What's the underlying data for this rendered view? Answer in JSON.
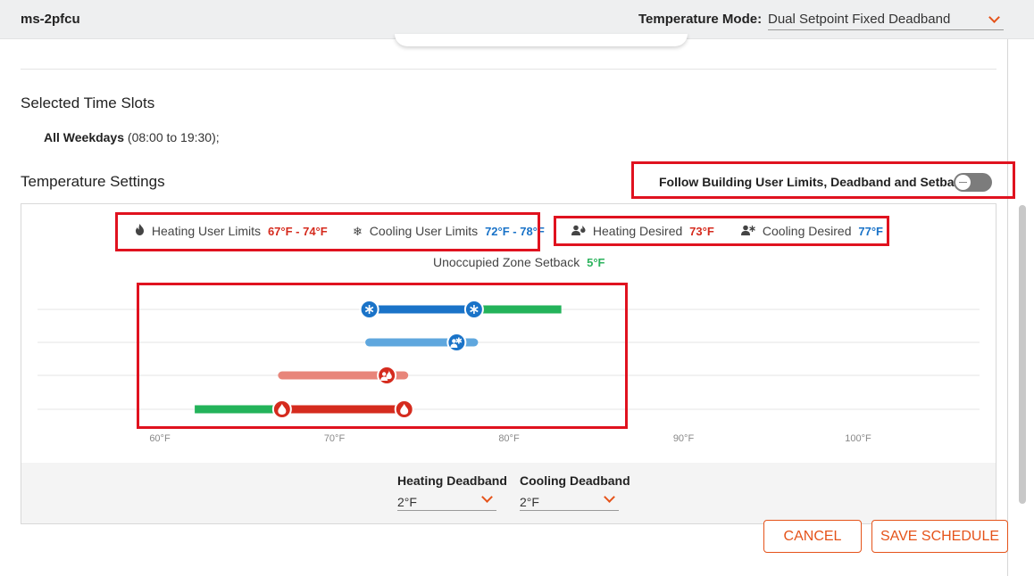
{
  "header": {
    "title": "ms-2pfcu",
    "mode_label": "Temperature Mode:",
    "mode_value": "Dual Setpoint Fixed Deadband"
  },
  "time_slots": {
    "title": "Selected Time Slots",
    "day": "All Weekdays",
    "range": "(08:00 to 19:30);"
  },
  "temperature_settings": {
    "title": "Temperature Settings",
    "follow_label": "Follow Building User Limits, Deadband and Setback",
    "follow_enabled": false
  },
  "legend": {
    "heating_limits_label": "Heating User Limits",
    "heating_limits_value": "67°F - 74°F",
    "cooling_limits_label": "Cooling User Limits",
    "cooling_limits_value": "72°F - 78°F",
    "heating_desired_label": "Heating Desired",
    "heating_desired_value": "73°F",
    "cooling_desired_label": "Cooling Desired",
    "cooling_desired_value": "77°F",
    "setback_label": "Unoccupied Zone Setback",
    "setback_value": "5°F"
  },
  "colors": {
    "heating": "#d52b1e",
    "heating_light": "#e8857a",
    "cooling": "#1a73c8",
    "cooling_light": "#5fa7de",
    "setback": "#23b35a",
    "accent": "#e5531a"
  },
  "chart_data": {
    "type": "range",
    "x_ticks": [
      "60°F",
      "70°F",
      "80°F",
      "90°F",
      "100°F"
    ],
    "xlim": [
      60,
      100
    ],
    "rows": [
      {
        "name": "cooling_limits",
        "min": 72,
        "max": 78,
        "setback_to": 83
      },
      {
        "name": "cooling_desired",
        "min": 72,
        "max": 78,
        "marker": 77
      },
      {
        "name": "heating_desired",
        "min": 67,
        "max": 74,
        "marker": 73
      },
      {
        "name": "heating_limits",
        "min": 67,
        "max": 74,
        "setback_from": 62
      }
    ]
  },
  "deadband": {
    "heating_label": "Heating Deadband",
    "heating_value": "2°F",
    "cooling_label": "Cooling Deadband",
    "cooling_value": "2°F"
  },
  "buttons": {
    "cancel": "CANCEL",
    "save": "SAVE SCHEDULE"
  }
}
